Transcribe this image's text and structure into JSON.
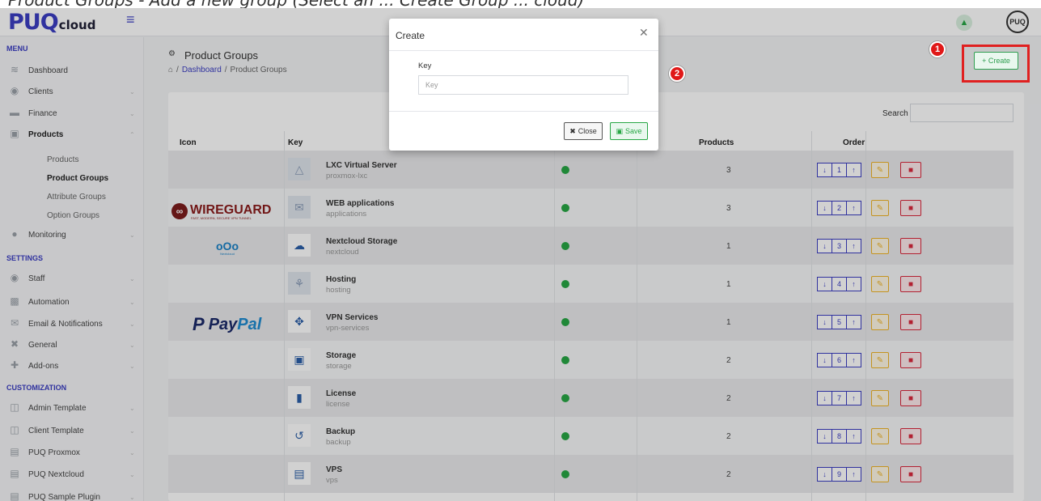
{
  "caption": "Product Groups - Add a new group (Select an ... Create Group ... cloud)",
  "header": {
    "logo_main": "PUQ",
    "logo_sub": "cloud",
    "avatar": "PUQ"
  },
  "sidebar": {
    "menu_title": "MENU",
    "settings_title": "SETTINGS",
    "customization_title": "CUSTOMIZATION",
    "menu_items": [
      {
        "label": "Dashboard"
      },
      {
        "label": "Clients"
      },
      {
        "label": "Finance"
      },
      {
        "label": "Products"
      },
      {
        "label": "Monitoring"
      }
    ],
    "products_sub": [
      "Products",
      "Product Groups",
      "Attribute Groups",
      "Option Groups"
    ],
    "settings_items": [
      {
        "label": "Staff"
      },
      {
        "label": "Automation"
      },
      {
        "label": "Email & Notifications"
      },
      {
        "label": "General"
      },
      {
        "label": "Add-ons"
      }
    ],
    "customization_items": [
      {
        "label": "Admin Template"
      },
      {
        "label": "Client Template"
      },
      {
        "label": "PUQ Proxmox"
      },
      {
        "label": "PUQ Nextcloud"
      },
      {
        "label": "PUQ Sample Plugin"
      }
    ]
  },
  "page": {
    "title": "Product Groups",
    "breadcrumb": [
      "Dashboard",
      "/",
      "Product Groups"
    ],
    "create_label": "+ Create",
    "badge_1": "1",
    "badge_2": "2"
  },
  "table": {
    "search_label": "Search",
    "headers": {
      "icon": "Icon",
      "key": "Key",
      "products": "Products",
      "order": "Order"
    },
    "rows": [
      {
        "name": "LXC Virtual Server",
        "slug": "proxmox-lxc",
        "products": "3",
        "order": "1"
      },
      {
        "name": "WEB applications",
        "slug": "applications",
        "products": "3",
        "order": "2"
      },
      {
        "name": "Nextcloud Storage",
        "slug": "nextcloud",
        "products": "1",
        "order": "3"
      },
      {
        "name": "Hosting",
        "slug": "hosting",
        "products": "1",
        "order": "4"
      },
      {
        "name": "VPN Services",
        "slug": "vpn-services",
        "products": "1",
        "order": "5"
      },
      {
        "name": "Storage",
        "slug": "storage",
        "products": "2",
        "order": "6"
      },
      {
        "name": "License",
        "slug": "license",
        "products": "2",
        "order": "7"
      },
      {
        "name": "Backup",
        "slug": "backup",
        "products": "2",
        "order": "8"
      },
      {
        "name": "VPS",
        "slug": "vps",
        "products": "2",
        "order": "9"
      }
    ],
    "logos": {
      "wireguard": "WIREGUARD",
      "wireguard_tag": "FAST, MODERN, SECURE VPN TUNNEL",
      "nextcloud": "Nextcloud",
      "paypal_1": "Pay",
      "paypal_2": "Pal"
    }
  },
  "modal": {
    "title": "Create",
    "key_label": "Key",
    "key_placeholder": "Key",
    "key_value": "",
    "close_label": "Close",
    "save_label": "Save"
  }
}
